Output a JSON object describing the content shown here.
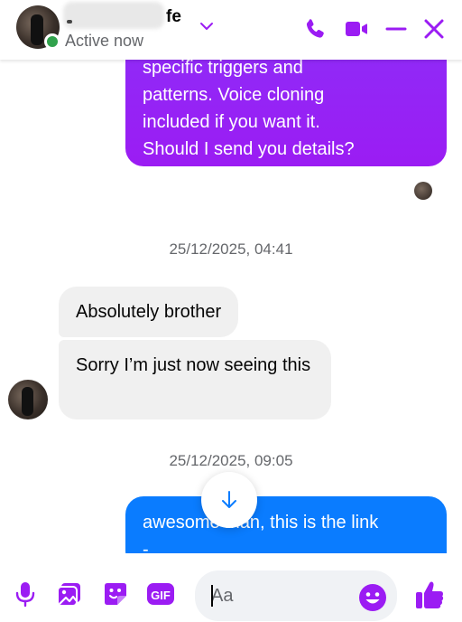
{
  "header": {
    "name_visible": "fe",
    "status": "Active now"
  },
  "colors": {
    "accent": "#9b1cf3",
    "outgoing_bubble": "#8f2bf7",
    "blue_bubble": "#0a7cff",
    "incoming_bubble": "#f0f0f0",
    "presence": "#31a24c"
  },
  "icons": [
    "voice-call-icon",
    "video-call-icon",
    "minimize-icon",
    "close-icon",
    "microphone-icon",
    "image-icon",
    "sticker-icon",
    "gif-icon",
    "emoji-icon",
    "like-icon",
    "arrow-down-icon",
    "chevron-down-icon"
  ],
  "messages": {
    "outgoing_1": {
      "lines": [
        "specific triggers and",
        "patterns. Voice cloning",
        "included if you want it.",
        "Should I send you details?"
      ]
    },
    "timestamp_1": "25/12/2025, 04:41",
    "incoming_1": "Absolutely brother",
    "incoming_2": "Sorry I’m just now seeing this",
    "timestamp_2": "25/12/2025, 09:05",
    "outgoing_2": {
      "lines": [
        "awesome man, this is the link",
        "-"
      ]
    }
  },
  "composer": {
    "placeholder": "Aa",
    "gif_label": "GIF"
  }
}
